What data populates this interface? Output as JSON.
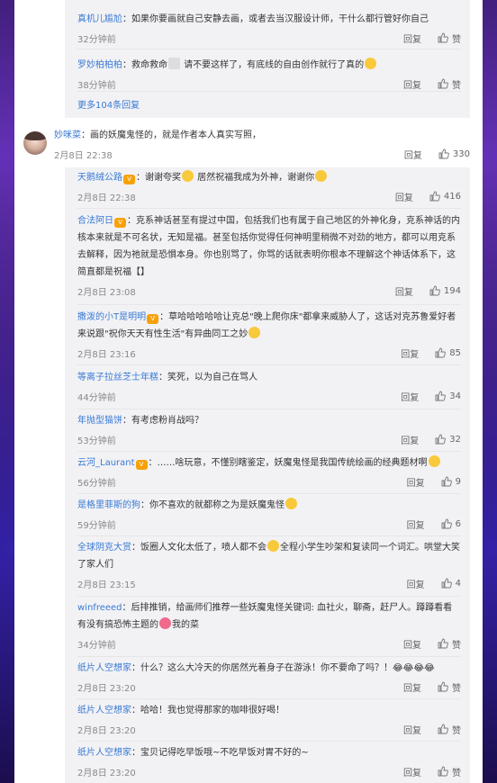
{
  "action": {
    "reply": "回复",
    "like": "赞"
  },
  "more_replies": "更多104条回复",
  "replies_top": [
    {
      "name": "真机儿尴尬",
      "text": "：如果你要画就自己安静去画，或者去当汉服设计师，干什么都行管好你自己",
      "time": "32分钟前",
      "likes": ""
    },
    {
      "name": "罗妙柏柏柏",
      "text": "：救命救命",
      "text2": " 请不要这样了，有底线的自由创作就行了真的",
      "time": "38分钟前",
      "likes": ""
    }
  ],
  "main": {
    "name": "妙咪菜",
    "text": "：画的妖魔鬼怪的，就是作者本人真实写照，",
    "time": "2月8日 22:38",
    "likes": "330"
  },
  "replies": [
    {
      "name": "天鹅绒公路",
      "badge": true,
      "text": "：谢谢夸奖",
      "emo1": true,
      "text2": " 居然祝福我成为外神，谢谢你",
      "emo2": true,
      "time": "2月8日 22:38",
      "likes": "416"
    },
    {
      "name": "合法阿日",
      "badge": true,
      "text": "：克系神话甚至有提过中国，包括我们也有属于自己地区的外神化身，克系神话的内核本来就是不可名状，无知是福。甚至包括你觉得任何神明里稍微不对劲的地方，都可以用克系去解释，因为祂就是恐惧本身。你也别骂了，你骂的话就表明你根本不理解这个神话体系下，这简直都是祝福【】",
      "time": "2月8日 23:08",
      "likes": "194"
    },
    {
      "name": "撒泼的小T是明明",
      "badge": true,
      "text": "：草哈哈哈哈哈让克总\"晚上爬你床\"都拿来威胁人了，这话对克苏鲁爱好者来说跟\"祝你天天有性生活\"有异曲同工之妙",
      "emo1": true,
      "time": "2月8日 23:16",
      "likes": "85"
    },
    {
      "name": "等离子拉丝芝士年糕",
      "text": "：笑死，以为自己在骂人",
      "time": "44分钟前",
      "likes": "34"
    },
    {
      "name": "年抛型猫饼",
      "text": "：有考虑粉肖战吗？",
      "time": "53分钟前",
      "likes": "32"
    },
    {
      "name": "云河_Laurant",
      "badge": true,
      "text": "：……啥玩意，不懂别瞎鉴定，妖魔鬼怪是我国传统绘画的经典题材啊",
      "emo1": true,
      "time": "56分钟前",
      "likes": "9"
    },
    {
      "name": "是格里菲斯的狗",
      "text": "：你不喜欢的就都称之为是妖魔鬼怪",
      "emo1": true,
      "time": "59分钟前",
      "likes": "6"
    },
    {
      "name": "全球阴克大赏",
      "text": "：饭圈人文化太低了，喷人都不会",
      "emo1": true,
      "text2": "全程小学生吵架和复读同一个词汇。哄堂大笑了家人们",
      "time": "2月8日 23:15",
      "likes": "4"
    },
    {
      "name": "winfreeed",
      "text": "：后排推销，给画师们推荐一些妖魔鬼怪关键词: 血社火，聊斋，赶尸人。蹲蹲看看有没有搞恐怖主题的",
      "emo1": true,
      "text2": "我的菜",
      "time": "34分钟前",
      "likes": ""
    },
    {
      "name": "纸片人空想家",
      "text": "：什么？这么大冷天的你居然光着身子在游泳！你不要命了吗？！😂😂😂😂",
      "time": "2月8日 23:20",
      "likes": ""
    },
    {
      "name": "纸片人空想家",
      "text": "：哈哈！我也觉得那家的咖啡很好喝！",
      "time": "2月8日 23:20",
      "likes": ""
    },
    {
      "name": "纸片人空想家",
      "text": "：宝贝记得吃早饭哦~不吃早饭对胃不好的~",
      "time": "2月8日 23:20",
      "likes": ""
    }
  ]
}
